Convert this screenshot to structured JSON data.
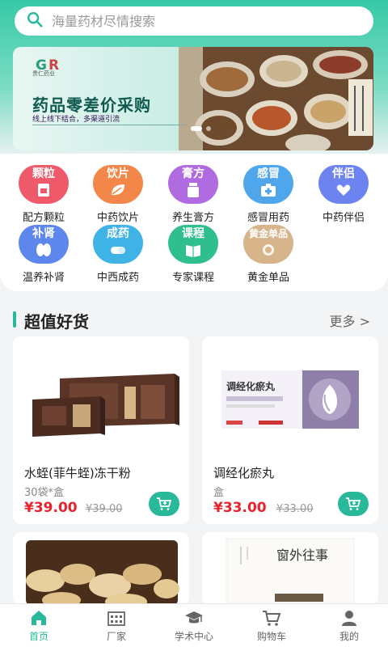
{
  "search": {
    "placeholder": "海量药材尽情搜索"
  },
  "banner": {
    "logo_text": "贵仁药业",
    "title": "药品零差价采购",
    "subtitle": "线上线下结合，多渠道引流"
  },
  "categories": [
    {
      "badge": "颗粒",
      "label": "配方颗粒",
      "color": "#ef5a6a",
      "icon": "granule-box-icon"
    },
    {
      "badge": "饮片",
      "label": "中药饮片",
      "color": "#f3874a",
      "icon": "leaf-icon"
    },
    {
      "badge": "膏方",
      "label": "养生膏方",
      "color": "#b06be0",
      "icon": "jar-icon"
    },
    {
      "badge": "感冒",
      "label": "感冒用药",
      "color": "#4fa6ea",
      "icon": "medkit-icon"
    },
    {
      "badge": "伴侣",
      "label": "中药伴侣",
      "color": "#6d83f0",
      "icon": "heart-hand-icon"
    },
    {
      "badge": "补肾",
      "label": "温养补肾",
      "color": "#5d87ec",
      "icon": "kidney-icon"
    },
    {
      "badge": "成药",
      "label": "中西成药",
      "color": "#3fb3e6",
      "icon": "capsule-icon"
    },
    {
      "badge": "课程",
      "label": "专家课程",
      "color": "#2fbf8e",
      "icon": "book-icon"
    },
    {
      "badge": "黄金单品",
      "label": "黄金单品",
      "color": "#d7b48a",
      "icon": "gold-item-icon"
    }
  ],
  "section": {
    "title": "超值好货",
    "more": "更多 >"
  },
  "products": [
    {
      "name": "水蛭(菲牛蛭)冻干粉",
      "spec": "30袋*盒",
      "price": "¥39.00",
      "original": "¥39.00"
    },
    {
      "name": "调经化瘀丸",
      "spec": "盒",
      "price": "¥33.00",
      "original": "¥33.00"
    }
  ],
  "product_images": {
    "box_label": "调经化瘀丸",
    "book_title": "窗外往事"
  },
  "tabs": [
    {
      "label": "首页",
      "icon": "home-icon",
      "active": true
    },
    {
      "label": "厂家",
      "icon": "factory-icon",
      "active": false
    },
    {
      "label": "学术中心",
      "icon": "graduation-cap-icon",
      "active": false
    },
    {
      "label": "购物车",
      "icon": "cart-icon",
      "active": false
    },
    {
      "label": "我的",
      "icon": "person-icon",
      "active": false
    }
  ],
  "colors": {
    "accent": "#28b89a",
    "price": "#e8232d"
  }
}
